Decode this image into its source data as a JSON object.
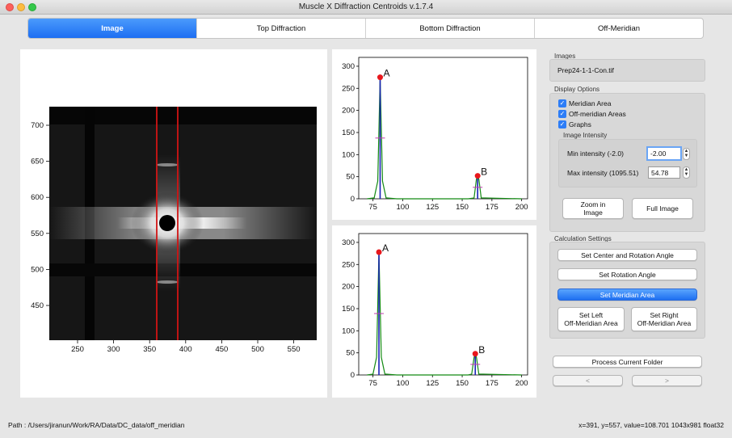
{
  "window": {
    "title": "Muscle X Diffraction Centroids v.1.7.4"
  },
  "tabs": [
    {
      "label": "Image"
    },
    {
      "label": "Top Diffraction"
    },
    {
      "label": "Bottom Diffraction"
    },
    {
      "label": "Off-Meridian"
    }
  ],
  "colors": {
    "accent": "#1d6ef2",
    "peak_marker": "#e8171c",
    "meridian_line": "#d11414"
  },
  "image_view": {
    "x_ticks": [
      "250",
      "300",
      "350",
      "400",
      "450",
      "500",
      "550"
    ],
    "y_ticks": [
      "700",
      "650",
      "600",
      "550",
      "500",
      "450"
    ]
  },
  "top_plot": {
    "y_ticks": [
      "0",
      "50",
      "100",
      "150",
      "200",
      "250",
      "300"
    ],
    "x_ticks": [
      "75",
      "100",
      "125",
      "150",
      "175",
      "200"
    ],
    "peak_a": "A",
    "peak_b": "B"
  },
  "bottom_plot": {
    "y_ticks": [
      "0",
      "50",
      "100",
      "150",
      "200",
      "250",
      "300"
    ],
    "x_ticks": [
      "75",
      "100",
      "125",
      "150",
      "175",
      "200"
    ],
    "peak_a": "A",
    "peak_b": "B"
  },
  "chart_data": [
    {
      "type": "line",
      "series": [
        {
          "values": [
            [
              70,
              0
            ],
            [
              76,
              2
            ],
            [
              79,
              40
            ],
            [
              81,
              275
            ],
            [
              83,
              40
            ],
            [
              86,
              2
            ],
            [
              95,
              0
            ],
            [
              155,
              0
            ],
            [
              160,
              2
            ],
            [
              162,
              45
            ],
            [
              163,
              52
            ],
            [
              164,
              45
            ],
            [
              166,
              2
            ],
            [
              200,
              0
            ]
          ]
        }
      ],
      "xlim": [
        63,
        205
      ],
      "ylim": [
        0,
        320
      ],
      "annotations": [
        {
          "label": "A",
          "x": 81,
          "y": 275
        },
        {
          "label": "B",
          "x": 163,
          "y": 52
        }
      ]
    },
    {
      "type": "line",
      "series": [
        {
          "values": [
            [
              70,
              0
            ],
            [
              75,
              2
            ],
            [
              78,
              40
            ],
            [
              80,
              278
            ],
            [
              82,
              40
            ],
            [
              85,
              2
            ],
            [
              95,
              0
            ],
            [
              155,
              0
            ],
            [
              158,
              2
            ],
            [
              160,
              40
            ],
            [
              161,
              48
            ],
            [
              162,
              40
            ],
            [
              164,
              2
            ],
            [
              200,
              0
            ]
          ]
        }
      ],
      "xlim": [
        63,
        205
      ],
      "ylim": [
        0,
        320
      ],
      "annotations": [
        {
          "label": "A",
          "x": 80,
          "y": 278
        },
        {
          "label": "B",
          "x": 161,
          "y": 48
        }
      ]
    }
  ],
  "sidebar": {
    "images_group": "Images",
    "image_file": "Prep24-1-1-Con.tif",
    "display_group": "Display Options",
    "meridian_area": "Meridian Area",
    "off_meridian_areas": "Off-meridian Areas",
    "graphs": "Graphs",
    "intensity_group": "Image Intensity",
    "min_label": "Min intensity (-2.0)",
    "min_value": "-2.00",
    "max_label": "Max intensity (1095.51)",
    "max_value": "54.78",
    "zoom_in": "Zoom in\nImage",
    "full_image": "Full Image",
    "calc_group": "Calculation Settings",
    "set_center": "Set Center and Rotation Angle",
    "set_rotation": "Set Rotation Angle",
    "set_meridian": "Set Meridian Area",
    "set_left": "Set Left\nOff-Meridian Area",
    "set_right": "Set Right\nOff-Meridian Area",
    "process_folder": "Process Current Folder",
    "prev": "<",
    "next": ">"
  },
  "status": {
    "path": "Path : /Users/jiranun/Work/RA/Data/DC_data/off_meridian",
    "info": "x=391, y=557, value=108.701  1043x981 float32"
  }
}
